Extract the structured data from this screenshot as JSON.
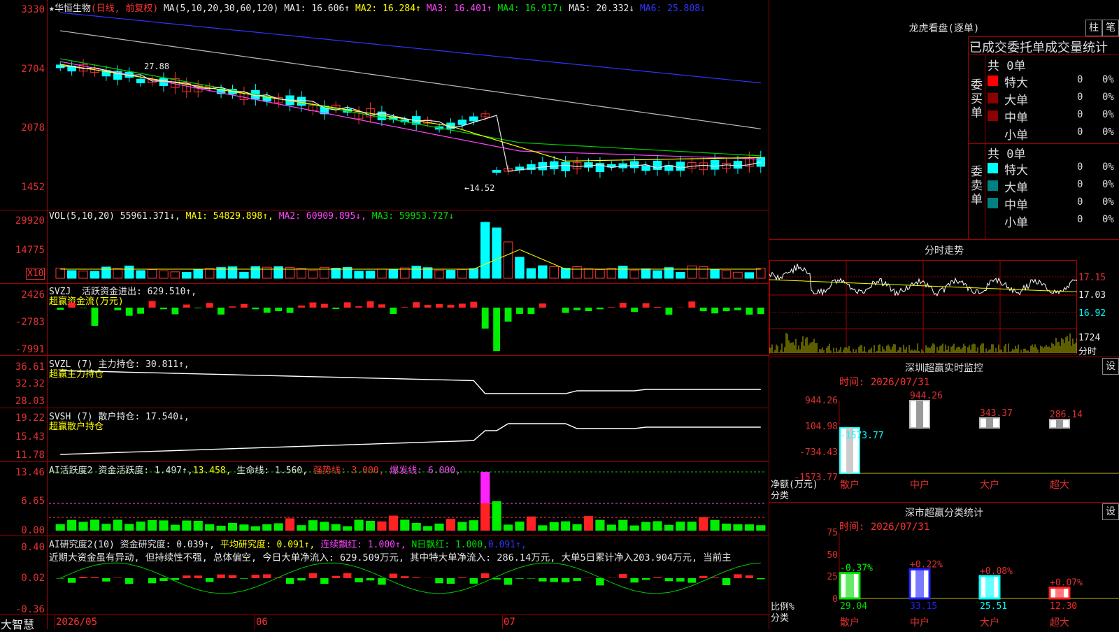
{
  "stock": {
    "name": "华恒生物",
    "mode": "(日线, 前复权)",
    "ma_label": "MA(5,10,20,30,60,120)",
    "ma1": "MA1: 16.606↑",
    "ma2": "MA2: 16.284↑",
    "ma3": "MA3: 16.401↑",
    "ma4": "MA4: 16.917↓",
    "ma5": "MA5: 20.332↓",
    "ma6": "MA6: 25.808↓",
    "price_axis": [
      "3330",
      "2704",
      "2078",
      "1452"
    ],
    "high_note": "27.88",
    "low_note": "←14.52"
  },
  "vol": {
    "label": "VOL(5,10,20)",
    "value": "55961.371↓,",
    "ma1": "MA1: 54829.898↑,",
    "ma2": "MA2: 60909.895↓,",
    "ma3": "MA3: 59953.727↓",
    "axis": [
      "29920",
      "14775"
    ],
    "unit": "X10"
  },
  "svzj": {
    "label": "SVZJ",
    "text": "活跃资金进出: 629.510↑,",
    "sub": "超赢资金流(万元)",
    "axis": [
      "2426",
      "-2783",
      "-7991"
    ]
  },
  "svzl": {
    "label": "SVZL (7)",
    "text": "主力持仓: 30.811↑,",
    "sub": "超赢主力持仓",
    "axis": [
      "36.61",
      "32.32",
      "28.03"
    ]
  },
  "svsh": {
    "label": "SVSH (7)",
    "text": "散户持仓: 17.540↓,",
    "sub": "超赢散户持仓",
    "axis": [
      "19.22",
      "15.43",
      "11.78"
    ]
  },
  "ai_active": {
    "label": "AI活跃度2",
    "t1": "资金活跃度: 1.497↑,",
    "t2": "13.458,",
    "t3": "生命线: 1.560,",
    "t4": "强势线: 3.000,",
    "t5": "爆发线: 6.000,",
    "axis": [
      "13.46",
      "6.65",
      "0.00"
    ]
  },
  "ai_research": {
    "label": "AI研究度2(10)",
    "t1": "资金研究度: 0.039↑,",
    "t2": "平均研究度: 0.091↑,",
    "t3": "连续飘红: 1.000↑,",
    "t4": "N日飘红: 1.000,",
    "t5": "0.091↑,",
    "comment": "近期大资金虽有异动, 但持续性不强, 总体偏空, 今日大单净流入: 629.509万元, 其中特大单净流入: 286.14万元, 大单5日累计净入203.904万元, 当前主",
    "axis": [
      "0.40",
      "0.02",
      "-0.36"
    ]
  },
  "bottom": {
    "brand": "大智慧",
    "dates": [
      "2026/05",
      "06",
      "07"
    ]
  },
  "longhu": {
    "title": "龙虎看盘(逐单)",
    "btn1": "柱",
    "btn2": "笔",
    "tabs": "已成交委托单成交量统计",
    "buy_label": "委买单",
    "sell_label": "委卖单",
    "buy_total": "共 0单",
    "sell_total": "共 0单",
    "rows": [
      "特大",
      "大单",
      "中单",
      "小单"
    ],
    "zero": "0",
    "pct": "0%",
    "buy_colors": [
      "#ff0000",
      "#8b0000",
      "#8b0000",
      "#000000"
    ],
    "sell_colors": [
      "#00ffff",
      "#008080",
      "#008080",
      "#000000"
    ]
  },
  "fenshi": {
    "title": "分时走势",
    "axis": [
      "17.15",
      "17.03",
      "16.92"
    ],
    "vol_axis": "1724",
    "unit": "分时"
  },
  "sz_monitor": {
    "title": "深圳超赢实时监控",
    "btn": "设",
    "time": "时间: 2026/07/31",
    "axis": [
      "944.26",
      "104.98",
      "-734.43",
      "-1573.77"
    ],
    "ylabel1": "净额(万元)",
    "ylabel2": "分类",
    "cats": [
      "散户",
      "中户",
      "大户",
      "超大"
    ],
    "values": [
      -1573.77,
      944.26,
      343.37,
      286.14
    ],
    "labels": [
      "-1573.77",
      "944.26",
      "343.37",
      "286.14"
    ]
  },
  "sz_class": {
    "title": "深市超赢分类统计",
    "btn": "设",
    "time": "时间: 2026/07/31",
    "axis": [
      "75",
      "50",
      "25",
      "0"
    ],
    "ylabel1": "比例%",
    "ylabel2": "分类",
    "cats": [
      "散户",
      "中户",
      "大户",
      "超大"
    ],
    "values": [
      29.04,
      33.15,
      25.51,
      12.3
    ],
    "changes": [
      "-0.37%",
      "+0.22%",
      "+0.08%",
      "+0.07%"
    ],
    "vlabels": [
      "29.04",
      "33.15",
      "25.51",
      "12.30"
    ],
    "colors": [
      "#00dd00",
      "#2222ff",
      "#00ffff",
      "#ff2222"
    ]
  }
}
